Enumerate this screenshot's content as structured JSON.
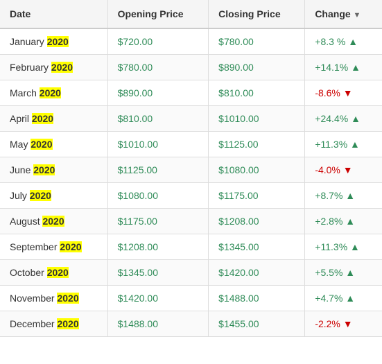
{
  "table": {
    "headers": [
      "Date",
      "Opening Price",
      "Closing Price",
      "Change"
    ],
    "sort_indicator": "▼",
    "rows": [
      {
        "month": "January",
        "year": "2020",
        "opening": "$720.00",
        "closing": "$780.00",
        "change": "+8.3 %",
        "direction": "up"
      },
      {
        "month": "February",
        "year": "2020",
        "opening": "$780.00",
        "closing": "$890.00",
        "change": "+14.1%",
        "direction": "up"
      },
      {
        "month": "March",
        "year": "2020",
        "opening": "$890.00",
        "closing": "$810.00",
        "change": "-8.6%",
        "direction": "down"
      },
      {
        "month": "April",
        "year": "2020",
        "opening": "$810.00",
        "closing": "$1010.00",
        "change": "+24.4%",
        "direction": "up"
      },
      {
        "month": "May",
        "year": "2020",
        "opening": "$1010.00",
        "closing": "$1125.00",
        "change": "+11.3%",
        "direction": "up"
      },
      {
        "month": "June",
        "year": "2020",
        "opening": "$1125.00",
        "closing": "$1080.00",
        "change": "-4.0%",
        "direction": "down"
      },
      {
        "month": "July",
        "year": "2020",
        "opening": "$1080.00",
        "closing": "$1175.00",
        "change": "+8.7%",
        "direction": "up"
      },
      {
        "month": "August",
        "year": "2020",
        "opening": "$1175.00",
        "closing": "$1208.00",
        "change": "+2.8%",
        "direction": "up"
      },
      {
        "month": "September",
        "year": "2020",
        "opening": "$1208.00",
        "closing": "$1345.00",
        "change": "+11.3%",
        "direction": "up"
      },
      {
        "month": "October",
        "year": "2020",
        "opening": "$1345.00",
        "closing": "$1420.00",
        "change": "+5.5%",
        "direction": "up"
      },
      {
        "month": "November",
        "year": "2020",
        "opening": "$1420.00",
        "closing": "$1488.00",
        "change": "+4.7%",
        "direction": "up"
      },
      {
        "month": "December",
        "year": "2020",
        "opening": "$1488.00",
        "closing": "$1455.00",
        "change": "-2.2%",
        "direction": "down"
      }
    ]
  }
}
